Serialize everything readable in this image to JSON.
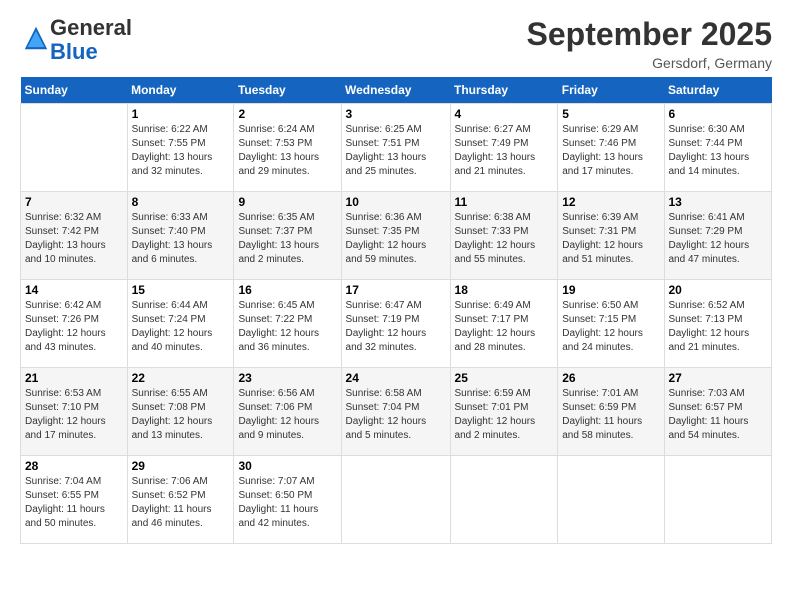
{
  "logo": {
    "general": "General",
    "blue": "Blue"
  },
  "header": {
    "month_year": "September 2025",
    "location": "Gersdorf, Germany"
  },
  "days_of_week": [
    "Sunday",
    "Monday",
    "Tuesday",
    "Wednesday",
    "Thursday",
    "Friday",
    "Saturday"
  ],
  "weeks": [
    [
      {
        "day": "",
        "sunrise": "",
        "sunset": "",
        "daylight": ""
      },
      {
        "day": "1",
        "sunrise": "Sunrise: 6:22 AM",
        "sunset": "Sunset: 7:55 PM",
        "daylight": "Daylight: 13 hours and 32 minutes."
      },
      {
        "day": "2",
        "sunrise": "Sunrise: 6:24 AM",
        "sunset": "Sunset: 7:53 PM",
        "daylight": "Daylight: 13 hours and 29 minutes."
      },
      {
        "day": "3",
        "sunrise": "Sunrise: 6:25 AM",
        "sunset": "Sunset: 7:51 PM",
        "daylight": "Daylight: 13 hours and 25 minutes."
      },
      {
        "day": "4",
        "sunrise": "Sunrise: 6:27 AM",
        "sunset": "Sunset: 7:49 PM",
        "daylight": "Daylight: 13 hours and 21 minutes."
      },
      {
        "day": "5",
        "sunrise": "Sunrise: 6:29 AM",
        "sunset": "Sunset: 7:46 PM",
        "daylight": "Daylight: 13 hours and 17 minutes."
      },
      {
        "day": "6",
        "sunrise": "Sunrise: 6:30 AM",
        "sunset": "Sunset: 7:44 PM",
        "daylight": "Daylight: 13 hours and 14 minutes."
      }
    ],
    [
      {
        "day": "7",
        "sunrise": "Sunrise: 6:32 AM",
        "sunset": "Sunset: 7:42 PM",
        "daylight": "Daylight: 13 hours and 10 minutes."
      },
      {
        "day": "8",
        "sunrise": "Sunrise: 6:33 AM",
        "sunset": "Sunset: 7:40 PM",
        "daylight": "Daylight: 13 hours and 6 minutes."
      },
      {
        "day": "9",
        "sunrise": "Sunrise: 6:35 AM",
        "sunset": "Sunset: 7:37 PM",
        "daylight": "Daylight: 13 hours and 2 minutes."
      },
      {
        "day": "10",
        "sunrise": "Sunrise: 6:36 AM",
        "sunset": "Sunset: 7:35 PM",
        "daylight": "Daylight: 12 hours and 59 minutes."
      },
      {
        "day": "11",
        "sunrise": "Sunrise: 6:38 AM",
        "sunset": "Sunset: 7:33 PM",
        "daylight": "Daylight: 12 hours and 55 minutes."
      },
      {
        "day": "12",
        "sunrise": "Sunrise: 6:39 AM",
        "sunset": "Sunset: 7:31 PM",
        "daylight": "Daylight: 12 hours and 51 minutes."
      },
      {
        "day": "13",
        "sunrise": "Sunrise: 6:41 AM",
        "sunset": "Sunset: 7:29 PM",
        "daylight": "Daylight: 12 hours and 47 minutes."
      }
    ],
    [
      {
        "day": "14",
        "sunrise": "Sunrise: 6:42 AM",
        "sunset": "Sunset: 7:26 PM",
        "daylight": "Daylight: 12 hours and 43 minutes."
      },
      {
        "day": "15",
        "sunrise": "Sunrise: 6:44 AM",
        "sunset": "Sunset: 7:24 PM",
        "daylight": "Daylight: 12 hours and 40 minutes."
      },
      {
        "day": "16",
        "sunrise": "Sunrise: 6:45 AM",
        "sunset": "Sunset: 7:22 PM",
        "daylight": "Daylight: 12 hours and 36 minutes."
      },
      {
        "day": "17",
        "sunrise": "Sunrise: 6:47 AM",
        "sunset": "Sunset: 7:19 PM",
        "daylight": "Daylight: 12 hours and 32 minutes."
      },
      {
        "day": "18",
        "sunrise": "Sunrise: 6:49 AM",
        "sunset": "Sunset: 7:17 PM",
        "daylight": "Daylight: 12 hours and 28 minutes."
      },
      {
        "day": "19",
        "sunrise": "Sunrise: 6:50 AM",
        "sunset": "Sunset: 7:15 PM",
        "daylight": "Daylight: 12 hours and 24 minutes."
      },
      {
        "day": "20",
        "sunrise": "Sunrise: 6:52 AM",
        "sunset": "Sunset: 7:13 PM",
        "daylight": "Daylight: 12 hours and 21 minutes."
      }
    ],
    [
      {
        "day": "21",
        "sunrise": "Sunrise: 6:53 AM",
        "sunset": "Sunset: 7:10 PM",
        "daylight": "Daylight: 12 hours and 17 minutes."
      },
      {
        "day": "22",
        "sunrise": "Sunrise: 6:55 AM",
        "sunset": "Sunset: 7:08 PM",
        "daylight": "Daylight: 12 hours and 13 minutes."
      },
      {
        "day": "23",
        "sunrise": "Sunrise: 6:56 AM",
        "sunset": "Sunset: 7:06 PM",
        "daylight": "Daylight: 12 hours and 9 minutes."
      },
      {
        "day": "24",
        "sunrise": "Sunrise: 6:58 AM",
        "sunset": "Sunset: 7:04 PM",
        "daylight": "Daylight: 12 hours and 5 minutes."
      },
      {
        "day": "25",
        "sunrise": "Sunrise: 6:59 AM",
        "sunset": "Sunset: 7:01 PM",
        "daylight": "Daylight: 12 hours and 2 minutes."
      },
      {
        "day": "26",
        "sunrise": "Sunrise: 7:01 AM",
        "sunset": "Sunset: 6:59 PM",
        "daylight": "Daylight: 11 hours and 58 minutes."
      },
      {
        "day": "27",
        "sunrise": "Sunrise: 7:03 AM",
        "sunset": "Sunset: 6:57 PM",
        "daylight": "Daylight: 11 hours and 54 minutes."
      }
    ],
    [
      {
        "day": "28",
        "sunrise": "Sunrise: 7:04 AM",
        "sunset": "Sunset: 6:55 PM",
        "daylight": "Daylight: 11 hours and 50 minutes."
      },
      {
        "day": "29",
        "sunrise": "Sunrise: 7:06 AM",
        "sunset": "Sunset: 6:52 PM",
        "daylight": "Daylight: 11 hours and 46 minutes."
      },
      {
        "day": "30",
        "sunrise": "Sunrise: 7:07 AM",
        "sunset": "Sunset: 6:50 PM",
        "daylight": "Daylight: 11 hours and 42 minutes."
      },
      {
        "day": "",
        "sunrise": "",
        "sunset": "",
        "daylight": ""
      },
      {
        "day": "",
        "sunrise": "",
        "sunset": "",
        "daylight": ""
      },
      {
        "day": "",
        "sunrise": "",
        "sunset": "",
        "daylight": ""
      },
      {
        "day": "",
        "sunrise": "",
        "sunset": "",
        "daylight": ""
      }
    ]
  ]
}
